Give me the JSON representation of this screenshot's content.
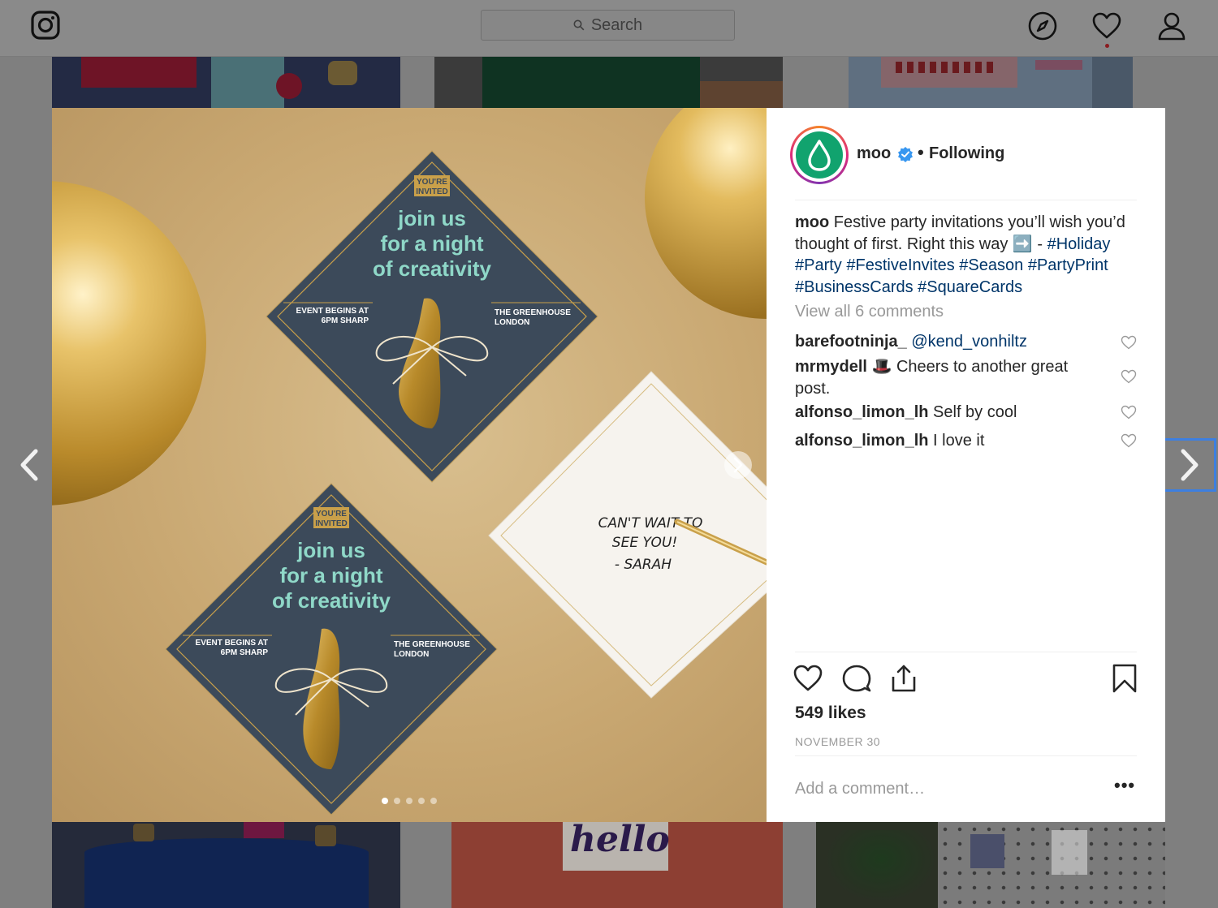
{
  "topbar": {
    "search_placeholder": "Search",
    "icons": [
      "instagram-logo-icon",
      "search-icon",
      "explore-compass-icon",
      "activity-heart-icon",
      "profile-user-icon"
    ]
  },
  "post": {
    "username": "moo",
    "follow_status": "Following",
    "caption_text": "Festive party invitations you’ll wish you’d thought of first. Right this way ➡️  -",
    "hashtags": "#Holiday #Party #FestiveInvites #Season #PartyPrint #BusinessCards #SquareCards",
    "view_all_comments": "View all 6 comments",
    "comments": [
      {
        "user": "barefootninja_",
        "text": "@kend_vonhiltz"
      },
      {
        "user": "mrmydell",
        "text": "🎩  Cheers to another great post."
      },
      {
        "user": "alfonso_limon_lh",
        "text": "Self by cool"
      },
      {
        "user": "alfonso_limon_lh",
        "text": "I love it"
      }
    ],
    "likes": "549 likes",
    "date": "NOVEMBER 30",
    "add_comment_placeholder": "Add a comment…",
    "more_label": "•••",
    "carousel": {
      "count": 5,
      "active": 0
    }
  },
  "photo": {
    "badge_line1": "YOU'RE",
    "badge_line2": "INVITED",
    "headline_1": "join us",
    "headline_2": "for a night",
    "headline_3": "of creativity",
    "left_info_1": "EVENT BEGINS AT",
    "left_info_2": "6PM SHARP",
    "right_info_1": "THE GREENHOUSE",
    "right_info_2": "LONDON",
    "note_1": "CAN'T WAIT TO",
    "note_2": "SEE YOU!",
    "note_3": "- SARAH",
    "background_tile_word": "hello"
  },
  "colors": {
    "card_navy": "#3c4a5a",
    "card_mint": "#8fd8c8",
    "gold": "#c9a04a",
    "link_blue": "#003569",
    "focus_blue": "#3d7fe0",
    "moo_green": "#11a36e"
  }
}
